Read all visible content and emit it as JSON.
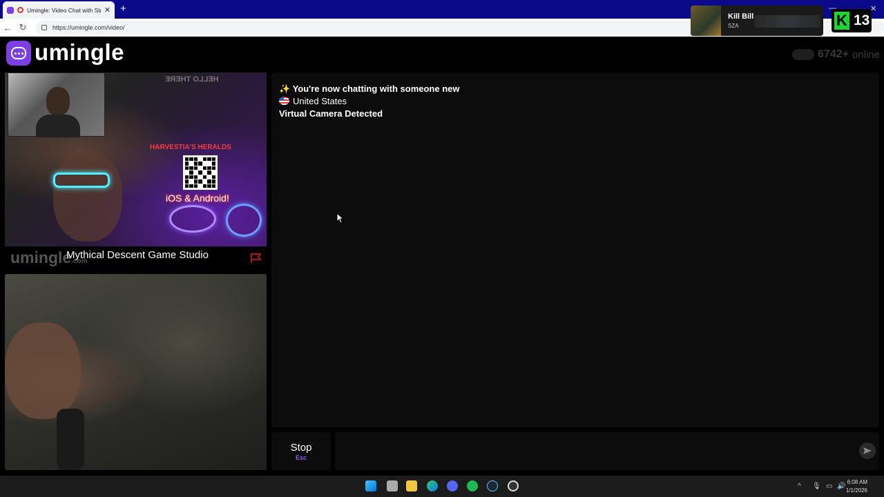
{
  "browser": {
    "tab_title": "Umingle: Video Chat with Stra",
    "tab_close": "✕",
    "new_tab": "+",
    "url": "https://umingle.com/video/",
    "back": "←",
    "reload": "↻"
  },
  "now_playing": {
    "title": "Kill Bill",
    "artist": "SZA"
  },
  "badge": {
    "letter": "K",
    "count": "13"
  },
  "header": {
    "logo_text": "umingle",
    "online_count": "6742+",
    "online_label": "online"
  },
  "stranger_video": {
    "hello_sign": "HELLO THERE",
    "heralds_sign": "HARVESTIA'S HERALDS",
    "ios_text": "iOS & Android!",
    "watermark": "umingle",
    "watermark_suffix": ".com",
    "label": "Mythical Descent Game Studio"
  },
  "chat": {
    "messages": {
      "m1": "✨ You're now chatting with someone new",
      "m2": "United States",
      "m3": "Virtual Camera Detected"
    }
  },
  "controls": {
    "stop_label": "Stop",
    "stop_key": "Esc",
    "input_placeholder": ""
  },
  "taskbar": {
    "time": "6:08 AM",
    "date": "1/1/2026"
  },
  "colors": {
    "brand": "#7b3fe4",
    "tabbar": "#0a0a8a",
    "chat_bg": "#0c0c0c",
    "hotkey": "#8b5cf6"
  }
}
